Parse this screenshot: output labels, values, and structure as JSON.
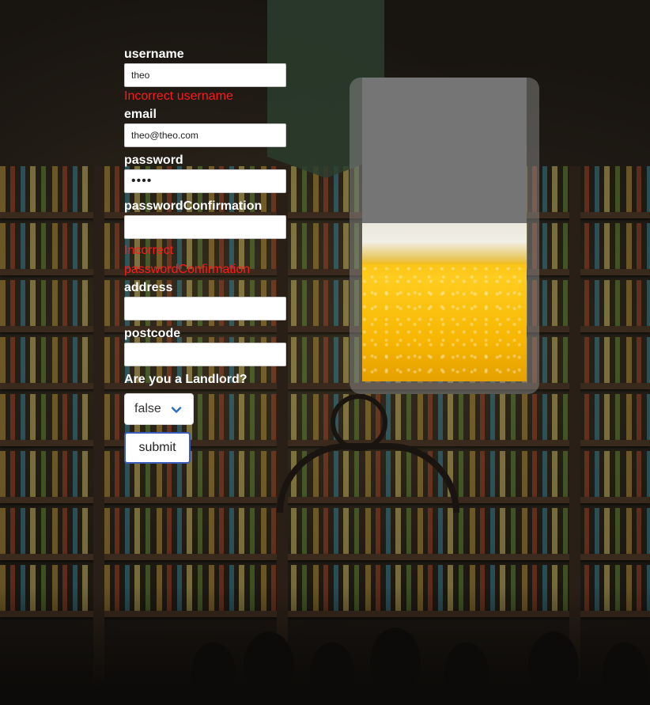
{
  "form": {
    "username": {
      "label": "username",
      "value": "theo",
      "error": "Incorrect username"
    },
    "email": {
      "label": "email",
      "value": "theo@theo.com"
    },
    "password": {
      "label": "password",
      "value": "••••"
    },
    "password_confirmation": {
      "label": "passwordConfirmation",
      "value": "",
      "error_line1": "Incorrect",
      "error_line2": "passwordConfirmation"
    },
    "address": {
      "label": "address",
      "value": ""
    },
    "postcode": {
      "label": "postcode",
      "value": ""
    },
    "landlord": {
      "label": "Are you a Landlord?",
      "selected": "false",
      "chevron_icon": "chevron-down-icon"
    },
    "submit_label": "submit"
  },
  "beer_glass": {
    "fill_level": 0.52
  },
  "colors": {
    "error": "#ff1a1a",
    "label": "#ffffff",
    "accent_border": "#3b5bb8",
    "chevron": "#2b6cc4"
  }
}
